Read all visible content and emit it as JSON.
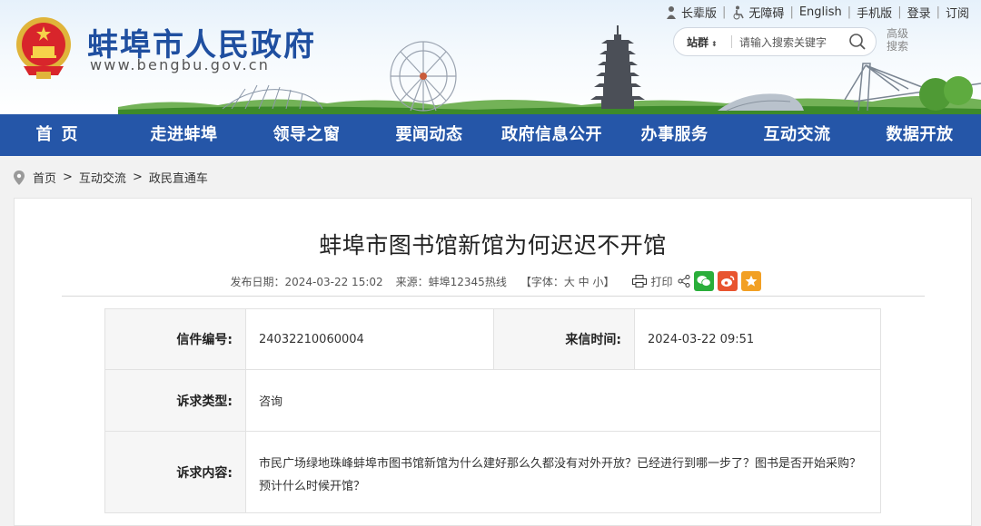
{
  "header": {
    "site_name": "蚌埠市人民政府",
    "site_url": "www.bengbu.gov.cn",
    "top_links": [
      "长辈版",
      "无障碍",
      "English",
      "手机版",
      "登录",
      "订阅"
    ],
    "search": {
      "scope": "站群",
      "placeholder": "请输入搜索关键字"
    },
    "advanced_search": [
      "高级",
      "搜索"
    ]
  },
  "nav": {
    "items": [
      "首页",
      "走进蚌埠",
      "领导之窗",
      "要闻动态",
      "政府信息公开",
      "办事服务",
      "互动交流",
      "数据开放"
    ]
  },
  "breadcrumb": {
    "items": [
      "首页",
      "互动交流",
      "政民直通车"
    ],
    "separator": ">"
  },
  "article": {
    "title": "蚌埠市图书馆新馆为何迟迟不开馆",
    "publish_date": "发布日期：2024-03-22 15:02",
    "source": "来源：蚌埠12345热线",
    "font_size_label": "【字体：大 中 小】",
    "print_label": "打印"
  },
  "letter": {
    "number_label": "信件编号:",
    "number_value": "24032210060004",
    "time_label": "来信时间:",
    "time_value": "2024-03-22 09:51",
    "type_label": "诉求类型:",
    "type_value": "咨询",
    "content_label": "诉求内容:",
    "content_value": "市民广场绿地珠峰蚌埠市图书馆新馆为什么建好那么久都没有对外开放？已经进行到哪一步了？图书是否开始采购？预计什么时候开馆？"
  },
  "colors": {
    "nav_bg": "#2556a8",
    "brand_blue": "#1f4fa0",
    "wechat": "#2aae3a",
    "weibo": "#e8542f",
    "favorite": "#f2a024"
  }
}
